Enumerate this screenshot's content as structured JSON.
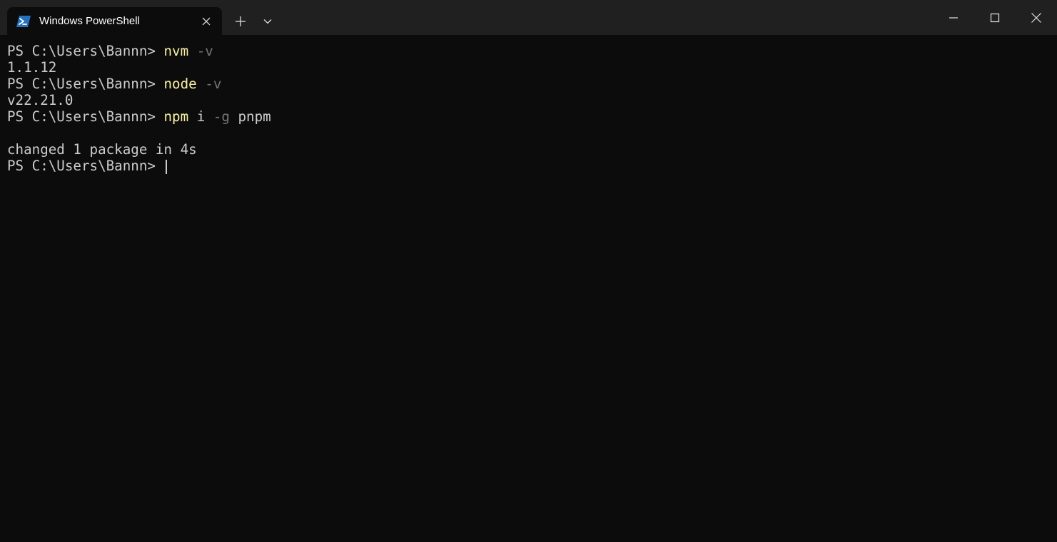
{
  "titlebar": {
    "tab_title": "Windows PowerShell",
    "tab_icon": "powershell-icon",
    "new_tab_icon": "plus-icon",
    "dropdown_icon": "chevron-down-icon",
    "caption_icons": [
      "minimize-icon",
      "maximize-icon",
      "close-icon"
    ]
  },
  "colors": {
    "titlebar_bg": "#202020",
    "terminal_bg": "#0c0c0c",
    "text": "#cccccc",
    "command": "#f9f1a5",
    "parameter": "#767676",
    "powershell_blue": "#2671be"
  },
  "terminal": {
    "prompt": "PS C:\\Users\\Bannn> ",
    "lines": [
      {
        "cmd": "nvm",
        "arg": " -v",
        "rest": ""
      },
      {
        "output": "1.1.12"
      },
      {
        "cmd": "node",
        "arg": " -v",
        "rest": ""
      },
      {
        "output": "v22.21.0"
      },
      {
        "cmd": "npm",
        "rest1": " i",
        "arg": " -g",
        "rest": " pnpm"
      },
      {
        "output": ""
      },
      {
        "output": "changed 1 package in 4s"
      }
    ]
  }
}
